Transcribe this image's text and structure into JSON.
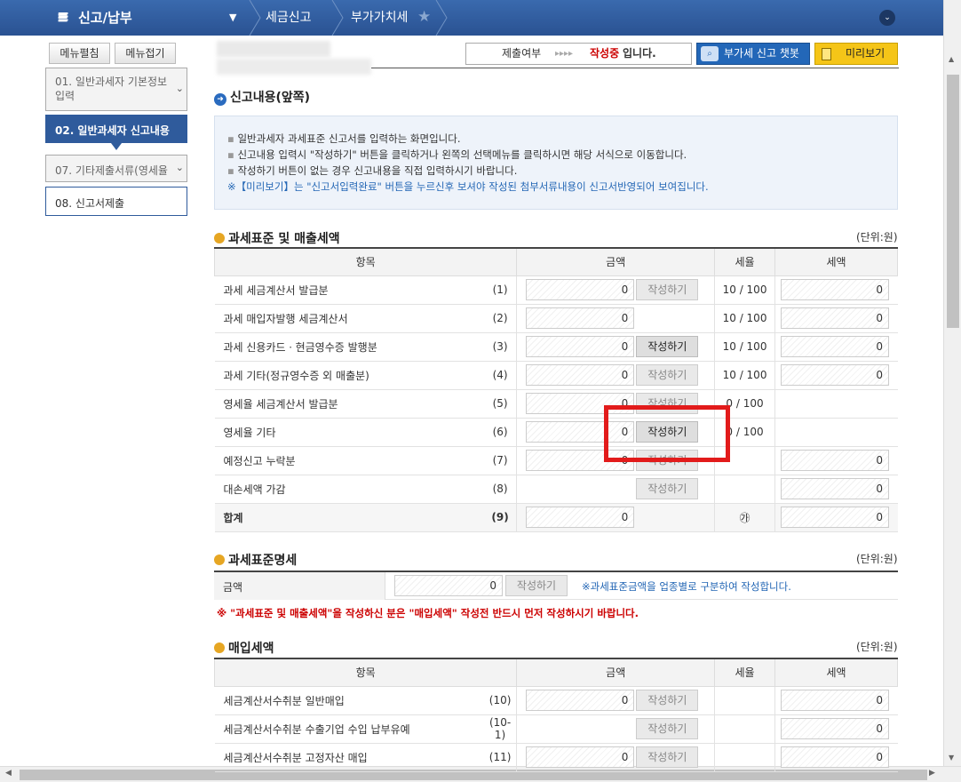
{
  "topbar": {
    "menu_title": "신고/납부",
    "crumbs": [
      "세금신고",
      "부가가치세"
    ]
  },
  "left": {
    "expand_label": "메뉴펼침",
    "collapse_label": "메뉴접기",
    "items": [
      {
        "label": "01. 일반과세자 기본정보입력"
      },
      {
        "label": "02. 일반과세자 신고내용"
      },
      {
        "label": "07. 기타제출서류(영세율"
      },
      {
        "label": "08. 신고서제출"
      }
    ]
  },
  "header": {
    "status_label": "제출여부",
    "status_arrows": "▸▸▸▸",
    "status_value": "작성중",
    "status_suffix": "입니다.",
    "chatbot_label": "부가세 신고 챗봇",
    "preview_label": "미리보기"
  },
  "section_main": {
    "title": "신고내용(앞쪽)"
  },
  "info": {
    "lines": [
      "일반과세자 과세표준 신고서를 입력하는 화면입니다.",
      "신고내용 입력시 \"작성하기\" 버튼을 클릭하거나 왼쪽의 선택메뉴를 클릭하시면 해당 서식으로 이동합니다.",
      "작성하기 버튼이 없는 경우 신고내용을 직접 입력하시기 바랍니다."
    ],
    "note": "※【미리보기】는 \"신고서입력완료\" 버튼을 누르신후 보셔야 작성된 첨부서류내용이 신고서반영되어 보여집니다."
  },
  "sec1": {
    "title": "과세표준 및 매출세액",
    "unit": "(단위:원)",
    "headers": [
      "항목",
      "금액",
      "세율",
      "세액"
    ],
    "write_label": "작성하기",
    "rows": [
      {
        "label": "과세 세금계산서 발급분",
        "no": "(1)",
        "amount": "0",
        "rate": "10 / 100",
        "tax": "0"
      },
      {
        "label": "과세 매입자발행 세금계산서",
        "no": "(2)",
        "amount": "0",
        "rate": "10 / 100",
        "tax": "0"
      },
      {
        "label": "과세 신용카드ㆍ현금영수증 발행분",
        "no": "(3)",
        "amount": "0",
        "rate": "10 / 100",
        "tax": "0"
      },
      {
        "label": "과세 기타(정규영수증 외 매출분)",
        "no": "(4)",
        "amount": "0",
        "rate": "10 / 100",
        "tax": "0"
      },
      {
        "label": "영세율 세금계산서 발급분",
        "no": "(5)",
        "amount": "0",
        "rate": "0 / 100",
        "tax": ""
      },
      {
        "label": "영세율 기타",
        "no": "(6)",
        "amount": "0",
        "rate": "0 / 100",
        "tax": ""
      },
      {
        "label": "예정신고 누락분",
        "no": "(7)",
        "amount": "0",
        "rate": "",
        "tax": "0"
      },
      {
        "label": "대손세액 가감",
        "no": "(8)",
        "amount": "",
        "rate": "",
        "tax": "0"
      },
      {
        "label": "합계",
        "no": "(9)",
        "amount": "0",
        "rate": "㉮",
        "tax": "0"
      }
    ]
  },
  "sec2": {
    "title": "과세표준명세",
    "unit": "(단위:원)",
    "row_label": "금액",
    "amount": "0",
    "write_label": "작성하기",
    "hint": "※과세표준금액을 업종별로 구분하여 작성합니다.",
    "warning": "※ \"과세표준 및 매출세액\"을 작성하신 분은 \"매입세액\" 작성전 반드시 먼저 작성하시기 바랍니다."
  },
  "sec3": {
    "title": "매입세액",
    "unit": "(단위:원)",
    "headers": [
      "항목",
      "금액",
      "세율",
      "세액"
    ],
    "write_label": "작성하기",
    "rows": [
      {
        "label": "세금계산서수취분 일반매입",
        "no": "(10)",
        "amount": "0",
        "tax": "0"
      },
      {
        "label": "세금계산서수취분 수출기업 수입 납부유예",
        "no": "(10-1)",
        "amount": "",
        "tax": "0"
      },
      {
        "label": "세금계산서수취분 고정자산 매입",
        "no": "(11)",
        "amount": "0",
        "tax": "0"
      }
    ]
  },
  "colors": {
    "topbar": "#2f5b9c",
    "active_menu": "#2f5b9c",
    "highlight": "#e21b1b",
    "status_red": "#cc0000"
  }
}
